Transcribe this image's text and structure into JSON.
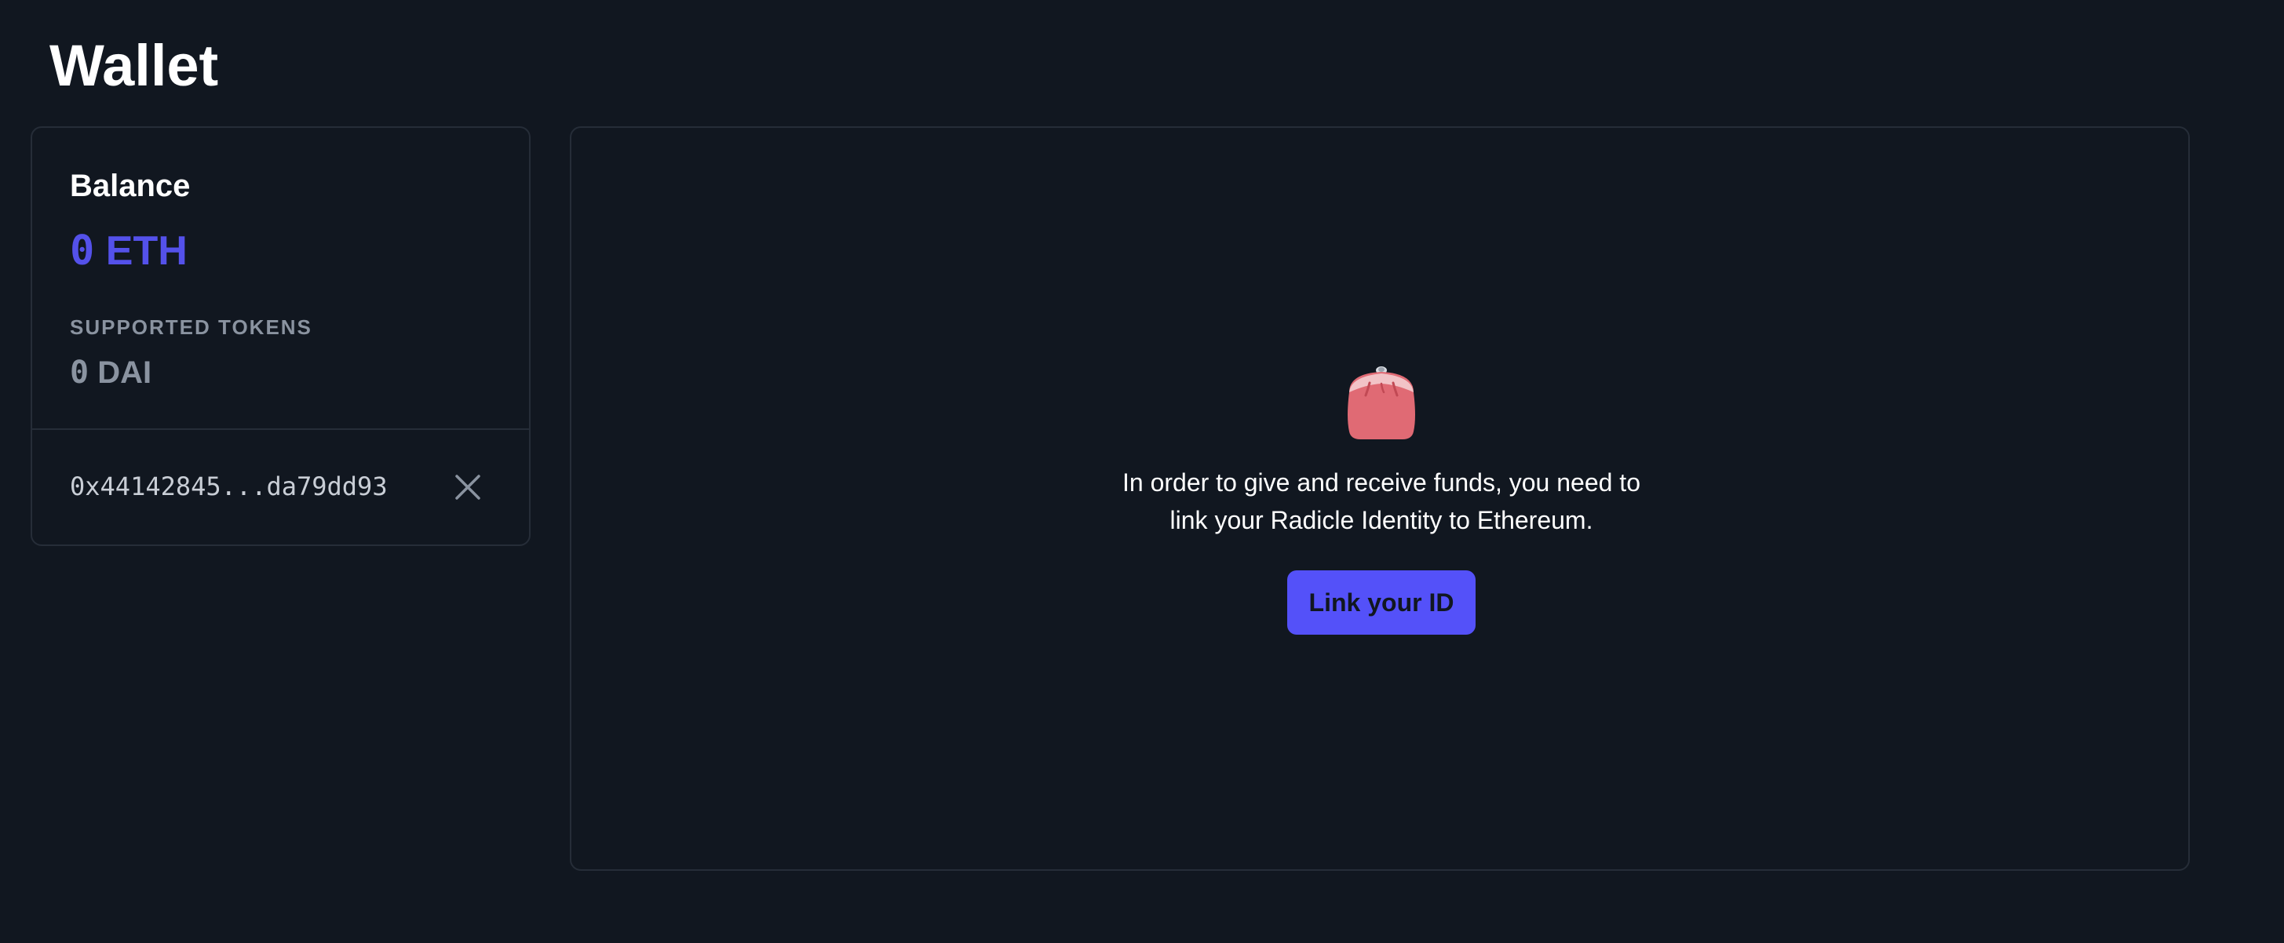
{
  "page": {
    "title": "Wallet"
  },
  "balance_card": {
    "heading": "Balance",
    "eth_value": "0",
    "eth_unit": "ETH",
    "tokens_label": "SUPPORTED TOKENS",
    "dai_value": "0",
    "dai_unit": "DAI",
    "address": "0x44142845...da79dd93",
    "close_icon": "close-icon"
  },
  "main_panel": {
    "icon": "purse-icon",
    "message_line1": "In order to give and receive funds, you need to",
    "message_line2": "link your Radicle Identity to Ethereum.",
    "link_button_label": "Link your ID"
  },
  "colors": {
    "background": "#111720",
    "accent": "#5451ea",
    "border": "#262d38",
    "muted_text": "#8a93a0",
    "purse": "#e06a74"
  }
}
